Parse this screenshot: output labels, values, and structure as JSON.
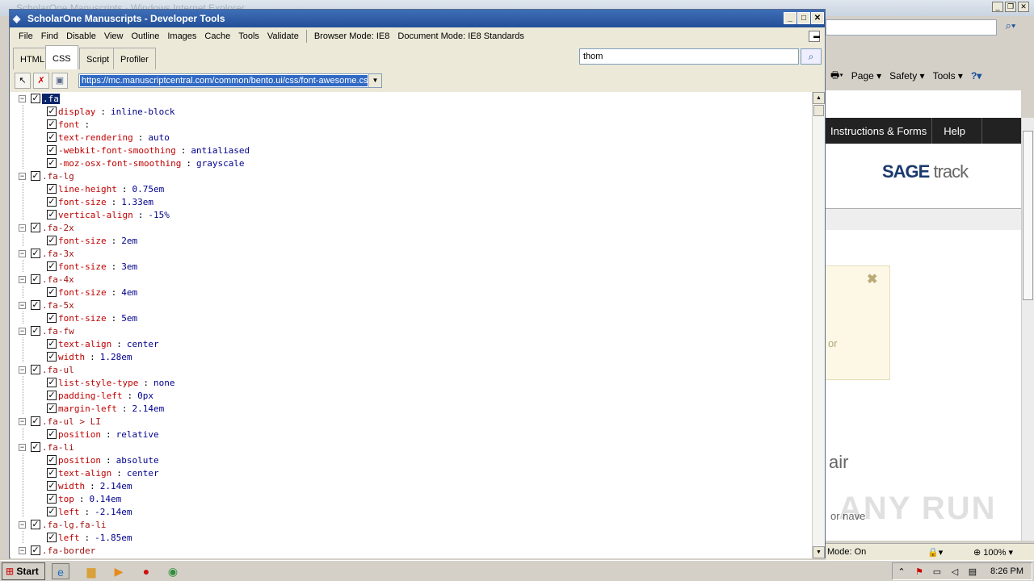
{
  "ie": {
    "title": "ScholarOne Manuscripts - Windows Internet Explorer",
    "cmdbar": [
      "Page ▾",
      "Safety ▾",
      "Tools ▾"
    ],
    "status_mode": "Mode: On",
    "zoom": "100%"
  },
  "site": {
    "nav": [
      "Instructions & Forms",
      "Help"
    ],
    "logo_sage": "SAGE",
    "logo_track": "track",
    "alert_fragment": "or",
    "text_air": "air",
    "text_ornave": "or nave"
  },
  "watermark": "ANY RUN",
  "devtools": {
    "title": "ScholarOne Manuscripts - Developer Tools",
    "menu": [
      "File",
      "Find",
      "Disable",
      "View",
      "Outline",
      "Images",
      "Cache",
      "Tools",
      "Validate"
    ],
    "browser_mode": "Browser Mode: IE8",
    "document_mode": "Document Mode: IE8 Standards",
    "tabs": [
      "HTML",
      "CSS",
      "Script",
      "Profiler"
    ],
    "active_tab": "CSS",
    "search_value": "thom",
    "stylesheet_url": "https://mc.manuscriptcentral.com/common/bento.ui/css/font-awesome.css",
    "rules": [
      {
        "selector": ".fa",
        "selected": true,
        "props": [
          {
            "name": "display",
            "value": "inline-block"
          },
          {
            "name": "font",
            "value": ""
          },
          {
            "name": "text-rendering",
            "value": "auto"
          },
          {
            "name": "-webkit-font-smoothing",
            "value": "antialiased"
          },
          {
            "name": "-moz-osx-font-smoothing",
            "value": "grayscale"
          }
        ]
      },
      {
        "selector": ".fa-lg",
        "props": [
          {
            "name": "line-height",
            "value": "0.75em"
          },
          {
            "name": "font-size",
            "value": "1.33em"
          },
          {
            "name": "vertical-align",
            "value": "-15%"
          }
        ]
      },
      {
        "selector": ".fa-2x",
        "props": [
          {
            "name": "font-size",
            "value": "2em"
          }
        ]
      },
      {
        "selector": ".fa-3x",
        "props": [
          {
            "name": "font-size",
            "value": "3em"
          }
        ]
      },
      {
        "selector": ".fa-4x",
        "props": [
          {
            "name": "font-size",
            "value": "4em"
          }
        ]
      },
      {
        "selector": ".fa-5x",
        "props": [
          {
            "name": "font-size",
            "value": "5em"
          }
        ]
      },
      {
        "selector": ".fa-fw",
        "props": [
          {
            "name": "text-align",
            "value": "center"
          },
          {
            "name": "width",
            "value": "1.28em"
          }
        ]
      },
      {
        "selector": ".fa-ul",
        "props": [
          {
            "name": "list-style-type",
            "value": "none"
          },
          {
            "name": "padding-left",
            "value": "0px"
          },
          {
            "name": "margin-left",
            "value": "2.14em"
          }
        ]
      },
      {
        "selector": ".fa-ul > LI",
        "props": [
          {
            "name": "position",
            "value": "relative"
          }
        ]
      },
      {
        "selector": ".fa-li",
        "props": [
          {
            "name": "position",
            "value": "absolute"
          },
          {
            "name": "text-align",
            "value": "center"
          },
          {
            "name": "width",
            "value": "2.14em"
          },
          {
            "name": "top",
            "value": "0.14em"
          },
          {
            "name": "left",
            "value": "-2.14em"
          }
        ]
      },
      {
        "selector": ".fa-lg.fa-li",
        "props": [
          {
            "name": "left",
            "value": "-1.85em"
          }
        ]
      },
      {
        "selector": ".fa-border",
        "props": []
      }
    ]
  },
  "taskbar": {
    "start": "Start",
    "clock": "8:26 PM"
  }
}
